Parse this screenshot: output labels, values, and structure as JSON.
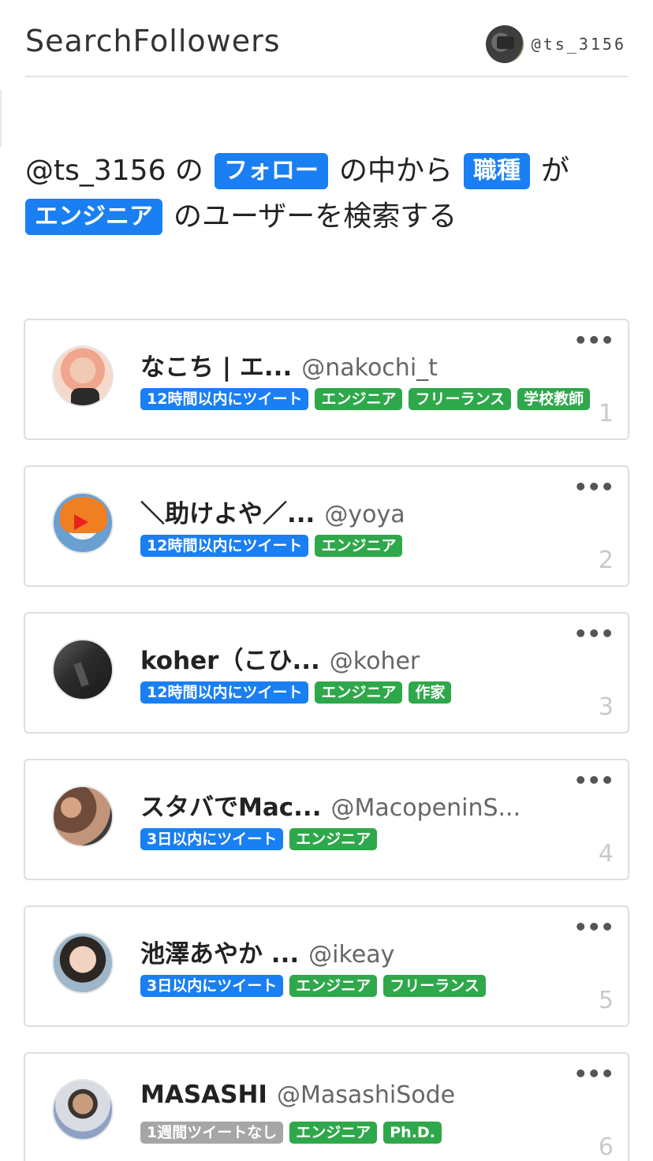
{
  "header": {
    "app_title": "SearchFollowers",
    "user_handle": "@ts_3156"
  },
  "query": {
    "prefix": "@ts_3156 の",
    "chip_relation": "フォロー",
    "mid": "の中から",
    "chip_field": "職種",
    "particle": "が",
    "chip_value": "エンジニア",
    "suffix": "のユーザーを検索する"
  },
  "results": [
    {
      "name": "なこち | エ...",
      "handle": "@nakochi_t",
      "rank": "1",
      "tags": [
        {
          "label": "12時間以内にツイート",
          "color": "blue"
        },
        {
          "label": "エンジニア",
          "color": "green"
        },
        {
          "label": "フリーランス",
          "color": "green"
        },
        {
          "label": "学校教師",
          "color": "green"
        }
      ]
    },
    {
      "name": "＼助けよや／...",
      "handle": "@yoya",
      "rank": "2",
      "tags": [
        {
          "label": "12時間以内にツイート",
          "color": "blue"
        },
        {
          "label": "エンジニア",
          "color": "green"
        }
      ]
    },
    {
      "name": "koher（こひ...",
      "handle": "@koher",
      "rank": "3",
      "tags": [
        {
          "label": "12時間以内にツイート",
          "color": "blue"
        },
        {
          "label": "エンジニア",
          "color": "green"
        },
        {
          "label": "作家",
          "color": "green"
        }
      ]
    },
    {
      "name": "スタバでMac...",
      "handle": "@MacopeninS...",
      "rank": "4",
      "tags": [
        {
          "label": "3日以内にツイート",
          "color": "blue"
        },
        {
          "label": "エンジニア",
          "color": "green"
        }
      ]
    },
    {
      "name": "池澤あやか ...",
      "handle": "@ikeay",
      "rank": "5",
      "tags": [
        {
          "label": "3日以内にツイート",
          "color": "blue"
        },
        {
          "label": "エンジニア",
          "color": "green"
        },
        {
          "label": "フリーランス",
          "color": "green"
        }
      ]
    },
    {
      "name": "MASASHI",
      "handle": "@MasashiSode",
      "rank": "6",
      "tags": [
        {
          "label": "1週間ツイートなし",
          "color": "gray"
        },
        {
          "label": "エンジニア",
          "color": "green"
        },
        {
          "label": "Ph.D.",
          "color": "green"
        }
      ]
    }
  ],
  "colors": {
    "accent_blue": "#1a7ff3",
    "tag_green": "#2ea84a",
    "tag_gray": "#a6a6a6"
  },
  "icons": {
    "more": "more-dots-icon"
  }
}
